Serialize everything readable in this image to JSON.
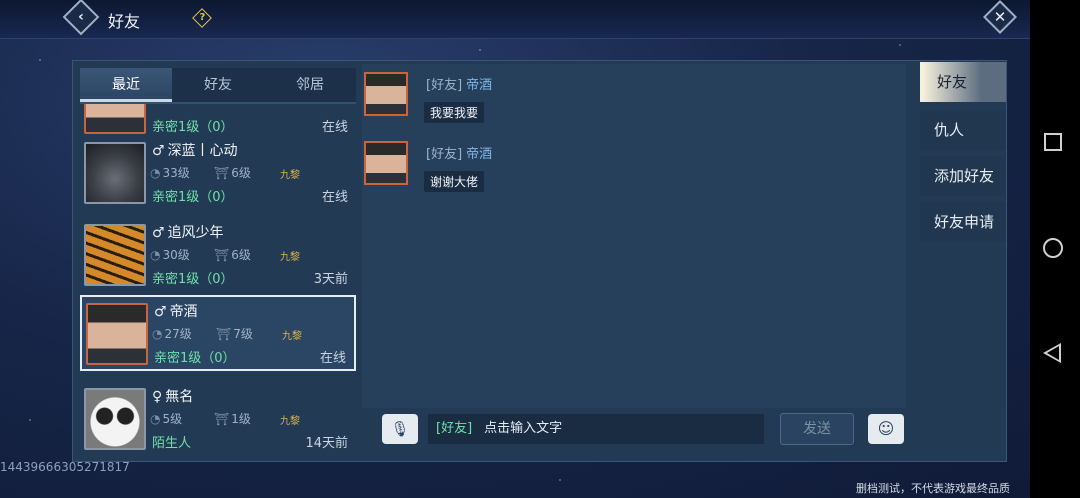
{
  "header": {
    "title": "好友",
    "back_icon": "‹",
    "help_icon": "?",
    "close_icon": "✕"
  },
  "tabs": [
    {
      "label": "最近",
      "active": true
    },
    {
      "label": "好友",
      "active": false
    },
    {
      "label": "邻居",
      "active": false
    }
  ],
  "partial_row": {
    "intimacy": "亲密1级（0）",
    "status": "在线"
  },
  "friends": [
    {
      "gender": "♂",
      "name": "深蓝丨心动",
      "level": "33级",
      "rank": "6级",
      "guild": "九黎",
      "intimacy": "亲密1级（0）",
      "status": "在线",
      "avatar": "wolf",
      "selected": false
    },
    {
      "gender": "♂",
      "name": "追风少年",
      "level": "30级",
      "rank": "6级",
      "guild": "九黎",
      "intimacy": "亲密1级（0）",
      "status": "3天前",
      "avatar": "tiger",
      "selected": false
    },
    {
      "gender": "♂",
      "name": "帝酒",
      "level": "27级",
      "rank": "7级",
      "guild": "九黎",
      "intimacy": "亲密1级（0）",
      "status": "在线",
      "avatar": "man",
      "selected": true
    },
    {
      "gender": "♀",
      "name": "無名",
      "level": "5级",
      "rank": "1级",
      "guild": "九黎",
      "intimacy": "陌生人",
      "status": "14天前",
      "avatar": "panda",
      "selected": false
    }
  ],
  "messages": [
    {
      "tag": "[好友]",
      "sender": "帝酒",
      "text": "我要我要"
    },
    {
      "tag": "[好友]",
      "sender": "帝酒",
      "text": "谢谢大佬"
    }
  ],
  "input": {
    "tag": "[好友]",
    "placeholder": "点击输入文字",
    "send_label": "发送",
    "voice_icon": "🎙",
    "emoji_icon": "☺"
  },
  "side_menu": [
    {
      "label": "好友",
      "active": true
    },
    {
      "label": "仇人",
      "active": false
    },
    {
      "label": "添加好友",
      "active": false
    },
    {
      "label": "好友申请",
      "active": false
    }
  ],
  "uid": "14439666305271817",
  "footer": "删档测试，不代表游戏最终品质",
  "colors": {
    "accent_green": "#6fe0a9",
    "name_blue": "#7fb8ea",
    "gold": "#d8b24a"
  }
}
